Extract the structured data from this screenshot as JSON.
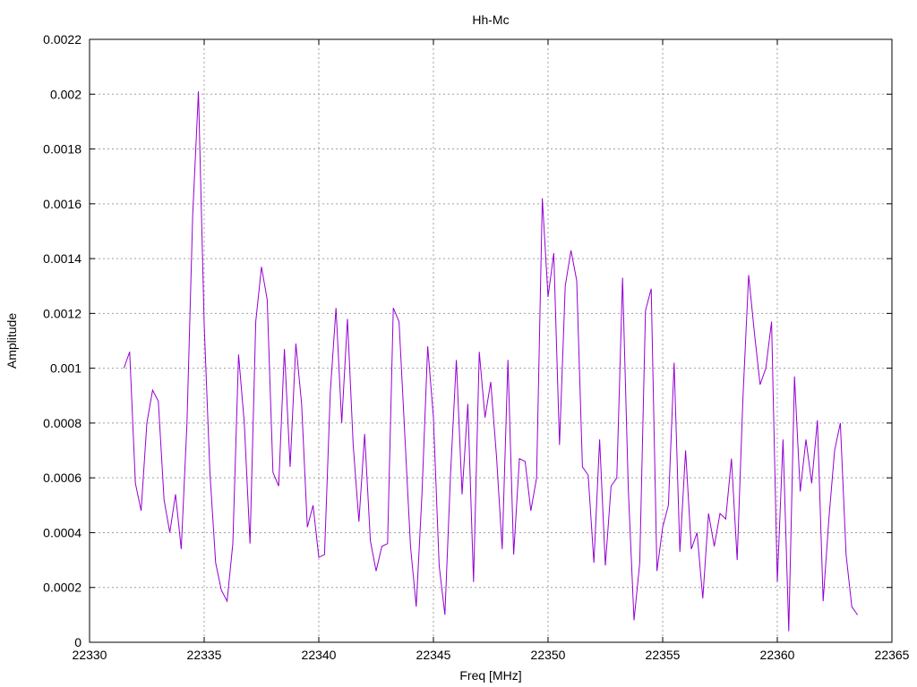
{
  "chart_data": {
    "type": "line",
    "title": "Hh-Mc",
    "xlabel": "Freq [MHz]",
    "ylabel": "Amplitude",
    "xlim": [
      22330,
      22365
    ],
    "ylim": [
      0,
      0.0022
    ],
    "xticks": [
      22330,
      22335,
      22340,
      22345,
      22350,
      22355,
      22360,
      22365
    ],
    "xtick_labels": [
      "22330",
      "22335",
      "22340",
      "22345",
      "22350",
      "22355",
      "22360",
      "22365"
    ],
    "yticks": [
      0,
      0.0002,
      0.0004,
      0.0006,
      0.0008,
      0.001,
      0.0012,
      0.0014,
      0.0016,
      0.0018,
      0.002,
      0.0022
    ],
    "ytick_labels": [
      "0",
      "0.0002",
      "0.0004",
      "0.0006",
      "0.0008",
      "0.001",
      "0.0012",
      "0.0014",
      "0.0016",
      "0.0018",
      "0.002",
      "0.0022"
    ],
    "grid": true,
    "legend": false,
    "colors": {
      "series": "#9400d3",
      "grid": "#a0a0a0",
      "axes": "#000000"
    },
    "series": [
      {
        "x": [
          22331.5,
          22331.75,
          22332.0,
          22332.25,
          22332.5,
          22332.75,
          22333.0,
          22333.25,
          22333.5,
          22333.75,
          22334.0,
          22334.25,
          22334.5,
          22334.75,
          22335.0,
          22335.25,
          22335.5,
          22335.75,
          22336.0,
          22336.25,
          22336.5,
          22336.75,
          22337.0,
          22337.25,
          22337.5,
          22337.75,
          22338.0,
          22338.25,
          22338.5,
          22338.75,
          22339.0,
          22339.25,
          22339.5,
          22339.75,
          22340.0,
          22340.25,
          22340.5,
          22340.75,
          22341.0,
          22341.25,
          22341.5,
          22341.75,
          22342.0,
          22342.25,
          22342.5,
          22342.75,
          22343.0,
          22343.25,
          22343.5,
          22343.75,
          22344.0,
          22344.25,
          22344.5,
          22344.75,
          22345.0,
          22345.25,
          22345.5,
          22345.75,
          22346.0,
          22346.25,
          22346.5,
          22346.75,
          22347.0,
          22347.25,
          22347.5,
          22347.75,
          22348.0,
          22348.25,
          22348.5,
          22348.75,
          22349.0,
          22349.25,
          22349.5,
          22349.75,
          22350.0,
          22350.25,
          22350.5,
          22350.75,
          22351.0,
          22351.25,
          22351.5,
          22351.75,
          22352.0,
          22352.25,
          22352.5,
          22352.75,
          22353.0,
          22353.25,
          22353.5,
          22353.75,
          22354.0,
          22354.25,
          22354.5,
          22354.75,
          22355.0,
          22355.25,
          22355.5,
          22355.75,
          22356.0,
          22356.25,
          22356.5,
          22356.75,
          22357.0,
          22357.25,
          22357.5,
          22357.75,
          22358.0,
          22358.25,
          22358.5,
          22358.75,
          22359.0,
          22359.25,
          22359.5,
          22359.75,
          22360.0,
          22360.25,
          22360.5,
          22360.75,
          22361.0,
          22361.25,
          22361.5,
          22361.75,
          22362.0,
          22362.25,
          22362.5,
          22362.75,
          22363.0,
          22363.25,
          22363.5
        ],
        "values": [
          0.001,
          0.00106,
          0.00058,
          0.00048,
          0.0008,
          0.00092,
          0.00088,
          0.00052,
          0.0004,
          0.00054,
          0.00034,
          0.0008,
          0.00156,
          0.00201,
          0.00116,
          0.00062,
          0.00029,
          0.00019,
          0.00015,
          0.00036,
          0.00105,
          0.0008,
          0.00036,
          0.00117,
          0.00137,
          0.00125,
          0.00062,
          0.00057,
          0.00107,
          0.00064,
          0.00109,
          0.00087,
          0.00042,
          0.0005,
          0.00031,
          0.00032,
          0.00091,
          0.00122,
          0.0008,
          0.00118,
          0.00072,
          0.00044,
          0.00076,
          0.00037,
          0.00026,
          0.00035,
          0.00036,
          0.00122,
          0.00117,
          0.00076,
          0.00035,
          0.00013,
          0.00054,
          0.00108,
          0.00082,
          0.00028,
          0.0001,
          0.00062,
          0.00103,
          0.00054,
          0.00087,
          0.00022,
          0.00106,
          0.00082,
          0.00095,
          0.00068,
          0.00034,
          0.00103,
          0.00032,
          0.00067,
          0.00066,
          0.00048,
          0.0006,
          0.00162,
          0.00126,
          0.00142,
          0.00072,
          0.0013,
          0.00143,
          0.00132,
          0.00064,
          0.00061,
          0.00029,
          0.00074,
          0.00028,
          0.00057,
          0.0006,
          0.00133,
          0.00056,
          8e-05,
          0.00029,
          0.00121,
          0.00129,
          0.00026,
          0.00042,
          0.0005,
          0.00102,
          0.00033,
          0.0007,
          0.00034,
          0.0004,
          0.00016,
          0.00047,
          0.00035,
          0.00047,
          0.00045,
          0.00067,
          0.0003,
          0.00089,
          0.00134,
          0.00113,
          0.00094,
          0.001,
          0.00117,
          0.00022,
          0.00074,
          4e-05,
          0.00097,
          0.00055,
          0.00074,
          0.00058,
          0.00081,
          0.00015,
          0.00045,
          0.0007,
          0.0008,
          0.00032,
          0.00013,
          0.0001
        ]
      }
    ]
  }
}
